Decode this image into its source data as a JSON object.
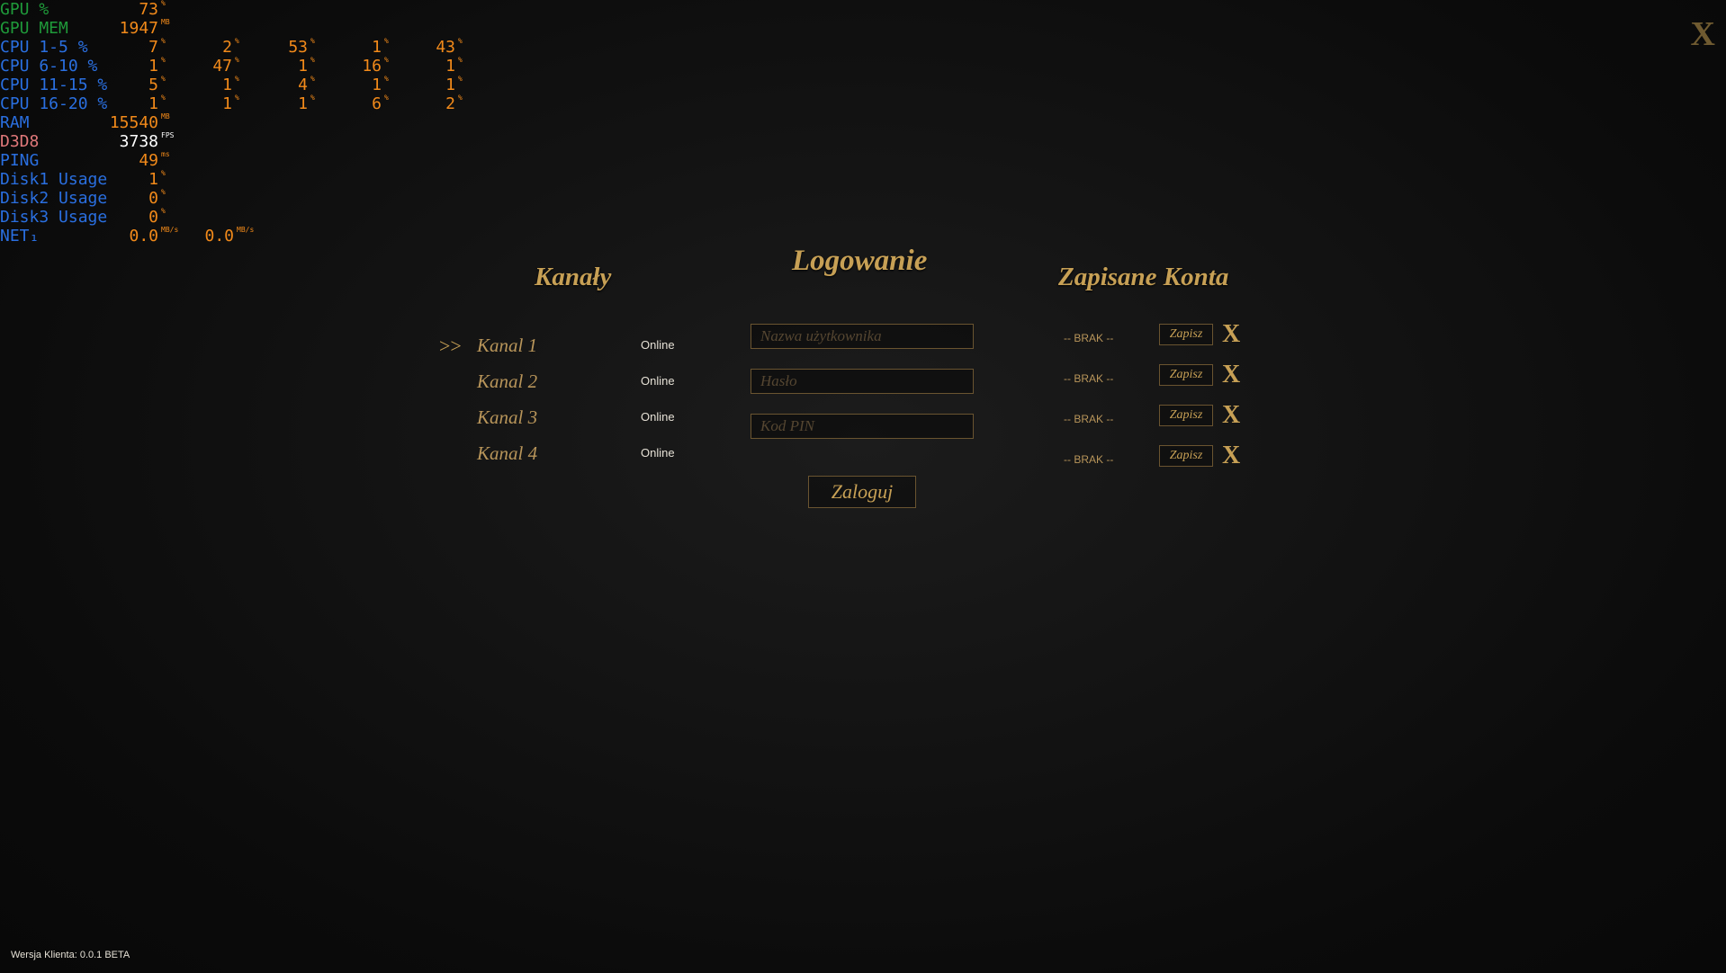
{
  "overlay": {
    "rows": [
      {
        "label": "GPU %",
        "color": "green",
        "values": [
          {
            "v": "73",
            "u": "%"
          }
        ]
      },
      {
        "label": "GPU MEM",
        "color": "green",
        "values": [
          {
            "v": "1947",
            "u": "MB"
          }
        ]
      },
      {
        "label": "CPU 1-5 %",
        "color": "blue",
        "values": [
          {
            "v": "7",
            "u": "%"
          },
          {
            "v": "2",
            "u": "%"
          },
          {
            "v": "53",
            "u": "%"
          },
          {
            "v": "1",
            "u": "%"
          },
          {
            "v": "43",
            "u": "%"
          }
        ]
      },
      {
        "label": "CPU 6-10 %",
        "color": "blue",
        "values": [
          {
            "v": "1",
            "u": "%"
          },
          {
            "v": "47",
            "u": "%"
          },
          {
            "v": "1",
            "u": "%"
          },
          {
            "v": "16",
            "u": "%"
          },
          {
            "v": "1",
            "u": "%"
          }
        ]
      },
      {
        "label": "CPU 11-15 %",
        "color": "blue",
        "values": [
          {
            "v": "5",
            "u": "%"
          },
          {
            "v": "1",
            "u": "%"
          },
          {
            "v": "4",
            "u": "%"
          },
          {
            "v": "1",
            "u": "%"
          },
          {
            "v": "1",
            "u": "%"
          }
        ]
      },
      {
        "label": "CPU 16-20 %",
        "color": "blue",
        "values": [
          {
            "v": "1",
            "u": "%"
          },
          {
            "v": "1",
            "u": "%"
          },
          {
            "v": "1",
            "u": "%"
          },
          {
            "v": "6",
            "u": "%"
          },
          {
            "v": "2",
            "u": "%"
          }
        ]
      },
      {
        "label": "RAM",
        "color": "blue",
        "values": [
          {
            "v": "15540",
            "u": "MB"
          }
        ]
      },
      {
        "label": "D3D8",
        "color": "pink",
        "values": [
          {
            "v": "3738",
            "u": "FPS",
            "white": true
          }
        ]
      },
      {
        "label": "PING",
        "color": "blue",
        "values": [
          {
            "v": "49",
            "u": "ms"
          }
        ]
      },
      {
        "label": "Disk1 Usage",
        "color": "blue",
        "values": [
          {
            "v": "1",
            "u": "%"
          }
        ]
      },
      {
        "label": "Disk2 Usage",
        "color": "blue",
        "values": [
          {
            "v": "0",
            "u": "%"
          }
        ]
      },
      {
        "label": "Disk3 Usage",
        "color": "blue",
        "values": [
          {
            "v": "0",
            "u": "%"
          }
        ]
      },
      {
        "label": "NET₁",
        "color": "blue",
        "values": [
          {
            "v": "0.0",
            "u": "MB/s"
          },
          {
            "v": "0.0",
            "u": "MB/s"
          }
        ]
      }
    ]
  },
  "window": {
    "close_label": "X"
  },
  "headings": {
    "channels": "Kanały",
    "login": "Logowanie",
    "saved": "Zapisane Konta"
  },
  "channels": [
    {
      "name": "Kanal 1",
      "status": "Online",
      "selected_marker": ">>"
    },
    {
      "name": "Kanal 2",
      "status": "Online",
      "selected_marker": ""
    },
    {
      "name": "Kanal 3",
      "status": "Online",
      "selected_marker": ""
    },
    {
      "name": "Kanal 4",
      "status": "Online",
      "selected_marker": ""
    }
  ],
  "login": {
    "username_placeholder": "Nazwa użytkownika",
    "password_placeholder": "Hasło",
    "pin_placeholder": "Kod PIN",
    "submit_label": "Zaloguj"
  },
  "saved_accounts": [
    {
      "label": "-- BRAK --",
      "save_label": "Zapisz",
      "delete_label": "X"
    },
    {
      "label": "-- BRAK --",
      "save_label": "Zapisz",
      "delete_label": "X"
    },
    {
      "label": "-- BRAK --",
      "save_label": "Zapisz",
      "delete_label": "X"
    },
    {
      "label": "-- BRAK --",
      "save_label": "Zapisz",
      "delete_label": "X"
    }
  ],
  "footer": {
    "version": "Wersja Klienta: 0.0.1 BETA"
  }
}
